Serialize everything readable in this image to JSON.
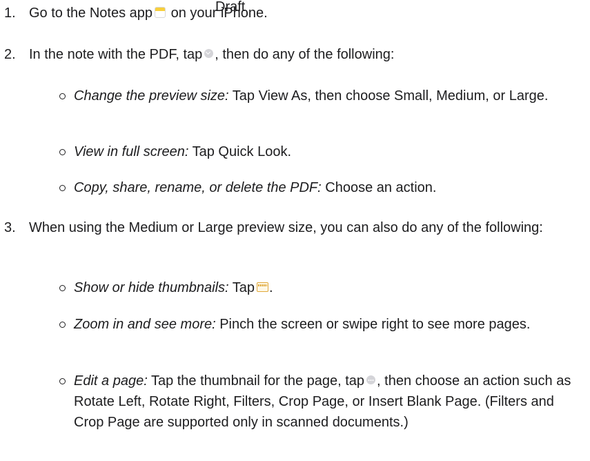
{
  "overlay": {
    "draft_label": "Draft"
  },
  "steps": [
    {
      "number": "1.",
      "text_before": "Go to the Notes app",
      "icon": "notes-app-icon",
      "text_after": " on your iPhone."
    },
    {
      "number": "2.",
      "text_before": "In the note with the PDF, tap",
      "icon": "chevron-down-circle-icon",
      "text_after": ", then do any of the following:",
      "items": [
        {
          "label": "Change the preview size:",
          "text": " Tap View As, then choose Small, Medium, or Large."
        },
        {
          "label": "View in full screen:",
          "text": " Tap Quick Look."
        },
        {
          "label": "Copy, share, rename, or delete the PDF:",
          "text": " Choose an action."
        }
      ]
    },
    {
      "number": "3.",
      "text": "When using the Medium or Large preview size, you can also do any of the following:",
      "items": [
        {
          "label": "Show or hide thumbnails:",
          "text_before": " Tap",
          "icon": "thumbnails-icon",
          "text_after": "."
        },
        {
          "label": "Zoom in and see more:",
          "text": " Pinch the screen or swipe right to see more pages."
        },
        {
          "label": "Edit a page:",
          "text_before": " Tap the thumbnail for the page, tap",
          "icon": "more-circle-icon",
          "text_after": ", then choose an action such as Rotate Left, Rotate Right, Filters, Crop Page, or Insert Blank Page. (Filters and Crop Page are supported only in scanned documents.)"
        }
      ]
    }
  ]
}
